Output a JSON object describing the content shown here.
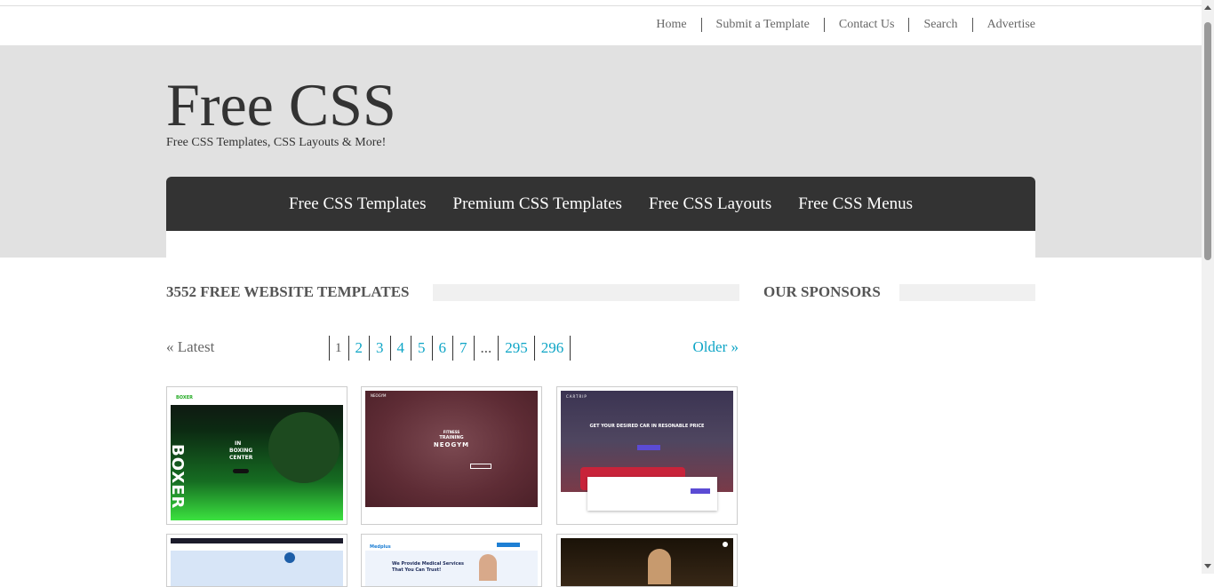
{
  "topnav": [
    "Home",
    "Submit a Template",
    "Contact Us",
    "Search",
    "Advertise"
  ],
  "site": {
    "title": "Free CSS",
    "tagline": "Free CSS Templates, CSS Layouts & More!"
  },
  "mainnav": [
    "Free CSS Templates",
    "Premium CSS Templates",
    "Free CSS Layouts",
    "Free CSS Menus"
  ],
  "content": {
    "heading": "3552 Free Website Templates"
  },
  "sidebar": {
    "heading": "Our Sponsors"
  },
  "pagination": {
    "latest": "« Latest",
    "older": "Older »",
    "pages": [
      "1",
      "2",
      "3",
      "4",
      "5",
      "6",
      "7",
      "...",
      "295",
      "296"
    ]
  },
  "thumbs": {
    "t1": {
      "brand": "BOXER",
      "line1": "IN",
      "line2": "BOXING",
      "line3": "CENTER",
      "vertical": "BOXER"
    },
    "t2": {
      "brand": "NEOGYM",
      "line1": "FITNESS",
      "line2": "TRAINING",
      "line3": "NEOGYM"
    },
    "t3": {
      "brand": "CARTRIP",
      "headline": "GET YOUR DESIRED CAR IN RESONABLE PRICE"
    },
    "t5": {
      "brand": "Medplus",
      "line1": "We Provide Medical Services",
      "line2": "That You Can Trust!"
    }
  },
  "colors": {
    "accent": "#0ea5c6",
    "nav": "#333333",
    "header": "#e1e1e1",
    "text": "#555555"
  }
}
